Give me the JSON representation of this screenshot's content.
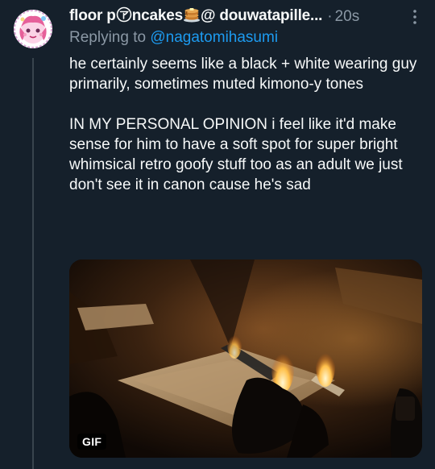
{
  "tweet": {
    "display_name": "floor p",
    "display_name_mid": "ncakes",
    "display_name_end": "@ douwatapille...",
    "time_separator": "·",
    "timestamp": "20s",
    "replying_to_label": "Replying to",
    "replying_to_handle": "@nagatomihasumi",
    "paragraph_1": "he certainly seems like a black + white wearing guy primarily, sometimes muted kimono-y tones",
    "paragraph_2": "IN MY PERSONAL OPINION i feel like it'd make sense for him to have a soft spot for super bright whimsical retro goofy stuff too as an adult we just don't see it in canon cause he's sad",
    "media_badge": "GIF"
  },
  "icons": {
    "avatar": "avatar",
    "name_emoji_1": "circled-katakana-a-icon",
    "name_emoji_2": "pancakes-icon",
    "more": "more-options-icon"
  },
  "colors": {
    "background": "#15202b",
    "text": "#f7f9f9",
    "secondary": "#8b98a5",
    "link": "#1d9bf0",
    "thread_line": "#38444d"
  }
}
